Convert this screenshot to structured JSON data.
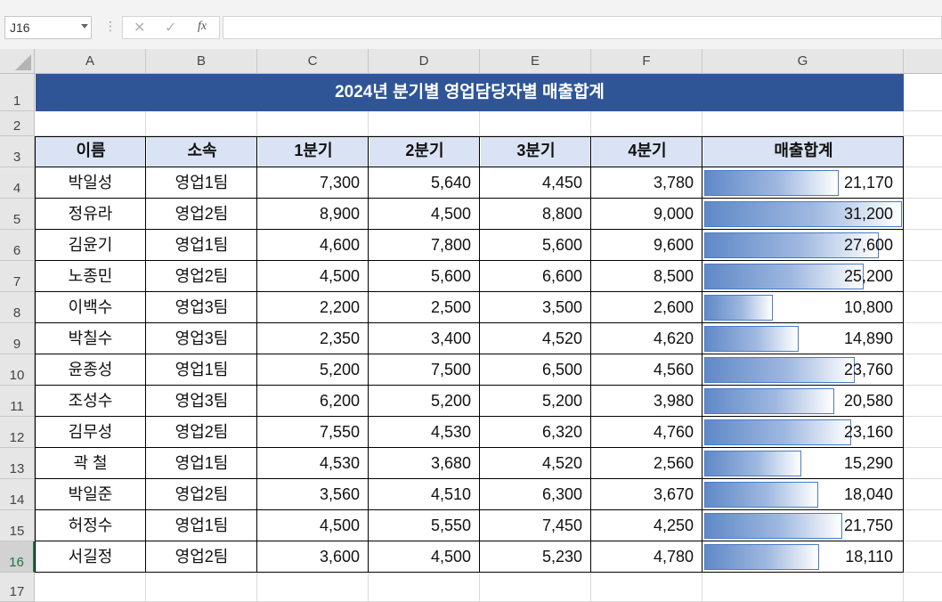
{
  "formula_bar": {
    "name_box": "J16",
    "cancel_icon": "✕",
    "enter_icon": "✓",
    "fx_label": "fx",
    "formula": ""
  },
  "columns": [
    "A",
    "B",
    "C",
    "D",
    "E",
    "F",
    "G"
  ],
  "rows": [
    "1",
    "2",
    "3",
    "4",
    "5",
    "6",
    "7",
    "8",
    "9",
    "10",
    "11",
    "12",
    "13",
    "14",
    "15",
    "16",
    "17"
  ],
  "active_row": "16",
  "title": "2024년 분기별 영업담당자별 매출합계",
  "headers": [
    "이름",
    "소속",
    "1분기",
    "2분기",
    "3분기",
    "4분기",
    "매출합계"
  ],
  "records": [
    {
      "name": "박일성",
      "team": "영업1팀",
      "q1": "7,300",
      "q2": "5,640",
      "q3": "4,450",
      "q4": "3,780",
      "total": "21,170",
      "total_num": 21170
    },
    {
      "name": "정유라",
      "team": "영업2팀",
      "q1": "8,900",
      "q2": "4,500",
      "q3": "8,800",
      "q4": "9,000",
      "total": "31,200",
      "total_num": 31200
    },
    {
      "name": "김윤기",
      "team": "영업1팀",
      "q1": "4,600",
      "q2": "7,800",
      "q3": "5,600",
      "q4": "9,600",
      "total": "27,600",
      "total_num": 27600
    },
    {
      "name": "노종민",
      "team": "영업2팀",
      "q1": "4,500",
      "q2": "5,600",
      "q3": "6,600",
      "q4": "8,500",
      "total": "25,200",
      "total_num": 25200
    },
    {
      "name": "이백수",
      "team": "영업3팀",
      "q1": "2,200",
      "q2": "2,500",
      "q3": "3,500",
      "q4": "2,600",
      "total": "10,800",
      "total_num": 10800
    },
    {
      "name": "박칠수",
      "team": "영업3팀",
      "q1": "2,350",
      "q2": "3,400",
      "q3": "4,520",
      "q4": "4,620",
      "total": "14,890",
      "total_num": 14890
    },
    {
      "name": "윤종성",
      "team": "영업1팀",
      "q1": "5,200",
      "q2": "7,500",
      "q3": "6,500",
      "q4": "4,560",
      "total": "23,760",
      "total_num": 23760
    },
    {
      "name": "조성수",
      "team": "영업3팀",
      "q1": "6,200",
      "q2": "5,200",
      "q3": "5,200",
      "q4": "3,980",
      "total": "20,580",
      "total_num": 20580
    },
    {
      "name": "김무성",
      "team": "영업2팀",
      "q1": "7,550",
      "q2": "4,530",
      "q3": "6,320",
      "q4": "4,760",
      "total": "23,160",
      "total_num": 23160
    },
    {
      "name": "곽   철",
      "team": "영업1팀",
      "q1": "4,530",
      "q2": "3,680",
      "q3": "4,520",
      "q4": "2,560",
      "total": "15,290",
      "total_num": 15290
    },
    {
      "name": "박일준",
      "team": "영업2팀",
      "q1": "3,560",
      "q2": "4,510",
      "q3": "6,300",
      "q4": "3,670",
      "total": "18,040",
      "total_num": 18040
    },
    {
      "name": "허정수",
      "team": "영업1팀",
      "q1": "4,500",
      "q2": "5,550",
      "q3": "7,450",
      "q4": "4,250",
      "total": "21,750",
      "total_num": 21750
    },
    {
      "name": "서길정",
      "team": "영업2팀",
      "q1": "3,600",
      "q2": "4,500",
      "q3": "5,230",
      "q4": "4,780",
      "total": "18,110",
      "total_num": 18110
    }
  ],
  "colors": {
    "title_bg": "#2f5597",
    "header_bg": "#dae3f3",
    "databar": "#5f89c7",
    "active_row": "#217346"
  }
}
